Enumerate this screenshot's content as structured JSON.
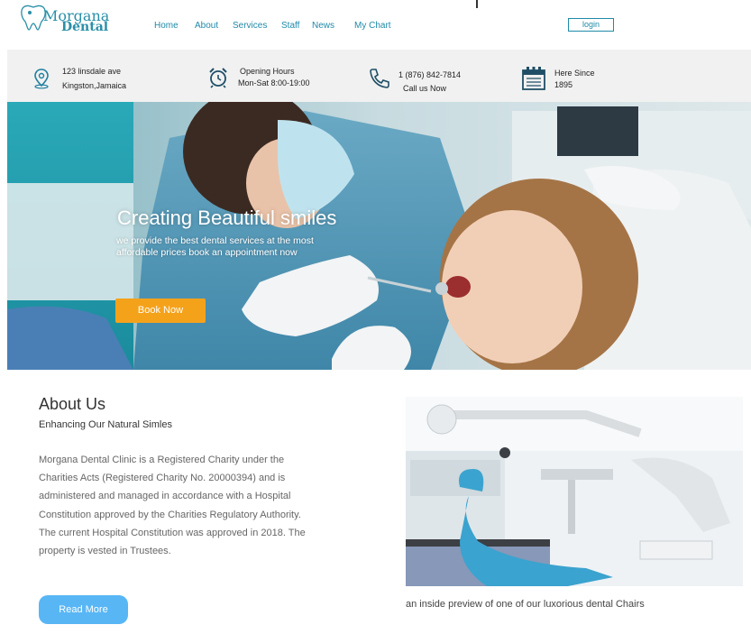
{
  "brand": {
    "name_line1": "Morgana",
    "name_line2": "Dental",
    "color": "#2a8fa8"
  },
  "nav": {
    "items": [
      {
        "label": "Home"
      },
      {
        "label": "About"
      },
      {
        "label": "Services"
      },
      {
        "label": "Staff"
      },
      {
        "label": "News"
      },
      {
        "label": "My Chart"
      }
    ],
    "login_label": "login"
  },
  "infobar": {
    "address": {
      "line1": "123 linsdale ave",
      "line2": "Kingston,Jamaica",
      "icon": "location-pin-icon"
    },
    "hours": {
      "line1": "Opening Hours",
      "line2": "Mon-Sat 8:00-19:00",
      "icon": "alarm-clock-icon"
    },
    "phone": {
      "line1": "1 (876) 842-7814",
      "line2": "Call us Now",
      "icon": "phone-icon"
    },
    "since": {
      "line1": "Here Since",
      "line2": "1895",
      "icon": "calendar-icon"
    }
  },
  "hero": {
    "title": "Creating Beautiful smiles",
    "subtitle": "we provide the best dental services at the most affordable prices book an appointment now",
    "button_label": "Book Now",
    "button_color": "#f5a21b"
  },
  "about": {
    "title": "About Us",
    "subtitle": "Enhancing Our Natural Simles",
    "body": "Morgana Dental Clinic is a Registered Charity under the Charities Acts (Registered Charity No. 20000394) and is administered and managed in accordance with a Hospital Constitution approved by the Charities Regulatory Authority. The current Hospital Constitution was approved in 2018. The property is vested in Trustees.",
    "button_label": "Read More",
    "button_color": "#58b6f5",
    "caption": "an  inside preview of one of our luxorious dental Chairs"
  }
}
